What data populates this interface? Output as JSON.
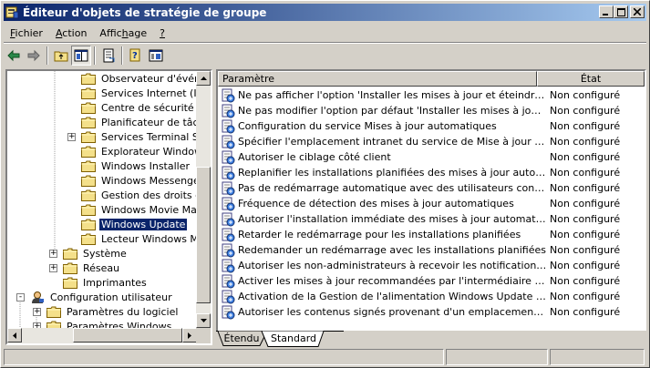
{
  "window": {
    "title": "Éditeur d'objets de stratégie de groupe"
  },
  "menu": [
    {
      "label": "Fichier",
      "accel": "F",
      "rest": "ichier"
    },
    {
      "label": "Action",
      "accel": "A",
      "rest": "ction"
    },
    {
      "label": "Affichage",
      "pre": "Affic",
      "accel": "h",
      "rest": "age"
    },
    {
      "label": "?",
      "accel": "?",
      "rest": ""
    }
  ],
  "toolbar": {
    "buttons": [
      "back-arrow-icon",
      "forward-arrow-icon",
      "up-folder-icon",
      "show-hide-tree-icon",
      "export-list-icon",
      "help-icon",
      "console-window-icon"
    ]
  },
  "tree": {
    "items": [
      {
        "label": "Observateur d'événem",
        "level": 4,
        "expander": ""
      },
      {
        "label": "Services Internet (IIS)",
        "level": 4,
        "expander": ""
      },
      {
        "label": "Centre de sécurité",
        "level": 4,
        "expander": ""
      },
      {
        "label": "Planificateur de tâches",
        "level": 4,
        "expander": ""
      },
      {
        "label": "Services Terminal Serv",
        "level": 4,
        "expander": "+"
      },
      {
        "label": "Explorateur Windows",
        "level": 4,
        "expander": ""
      },
      {
        "label": "Windows Installer",
        "level": 4,
        "expander": ""
      },
      {
        "label": "Windows Messenger",
        "level": 4,
        "expander": ""
      },
      {
        "label": "Gestion des droits de W",
        "level": 4,
        "expander": ""
      },
      {
        "label": "Windows Movie Maker",
        "level": 4,
        "expander": ""
      },
      {
        "label": "Windows Update",
        "level": 4,
        "expander": "",
        "selected": true
      },
      {
        "label": "Lecteur Windows Media",
        "level": 4,
        "expander": ""
      },
      {
        "label": "Système",
        "level": 3,
        "expander": "+"
      },
      {
        "label": "Réseau",
        "level": 3,
        "expander": "+"
      },
      {
        "label": "Imprimantes",
        "level": 3,
        "expander": ""
      },
      {
        "label": "Configuration utilisateur",
        "level": 1,
        "expander": "-",
        "user": true
      },
      {
        "label": "Paramètres du logiciel",
        "level": 2,
        "expander": "+"
      },
      {
        "label": "Paramètres Windows",
        "level": 2,
        "expander": "+"
      }
    ]
  },
  "list": {
    "columns": {
      "name": "Paramètre",
      "state": "État"
    },
    "rows": [
      {
        "name": "Ne pas afficher l'option 'Installer les mises à jour et éteindre' dans...",
        "state": "Non configuré"
      },
      {
        "name": "Ne pas modifier l'option par défaut 'Installer les mises à jour et ét...",
        "state": "Non configuré"
      },
      {
        "name": "Configuration du service Mises à jour automatiques",
        "state": "Non configuré"
      },
      {
        "name": "Spécifier l'emplacement intranet du service de Mise à jour Microsoft",
        "state": "Non configuré"
      },
      {
        "name": "Autoriser le ciblage côté client",
        "state": "Non configuré"
      },
      {
        "name": "Replanifier les installations planifiées des mises à jour automatiques",
        "state": "Non configuré"
      },
      {
        "name": "Pas de redémarrage automatique avec des utilisateurs connectés...",
        "state": "Non configuré"
      },
      {
        "name": "Fréquence de détection des mises à jour automatiques",
        "state": "Non configuré"
      },
      {
        "name": "Autoriser l'installation immédiate des mises à jour automatiques",
        "state": "Non configuré"
      },
      {
        "name": "Retarder le redémarrage pour les installations planifiées",
        "state": "Non configuré"
      },
      {
        "name": "Redemander un redémarrage avec les installations planifiées",
        "state": "Non configuré"
      },
      {
        "name": "Autoriser les non-administrateurs à recevoir les notifications de m...",
        "state": "Non configuré"
      },
      {
        "name": "Activer les mises à jour recommandées par l'intermédiaire des Mis...",
        "state": "Non configuré"
      },
      {
        "name": "Activation de la Gestion de l'alimentation Windows Update afin de...",
        "state": "Non configuré"
      },
      {
        "name": "Autoriser les contenus signés provenant d'un emplacement intran...",
        "state": "Non configuré"
      }
    ]
  },
  "tabs": [
    {
      "label": "Étendu",
      "active": false
    },
    {
      "label": "Standard",
      "active": true
    }
  ]
}
